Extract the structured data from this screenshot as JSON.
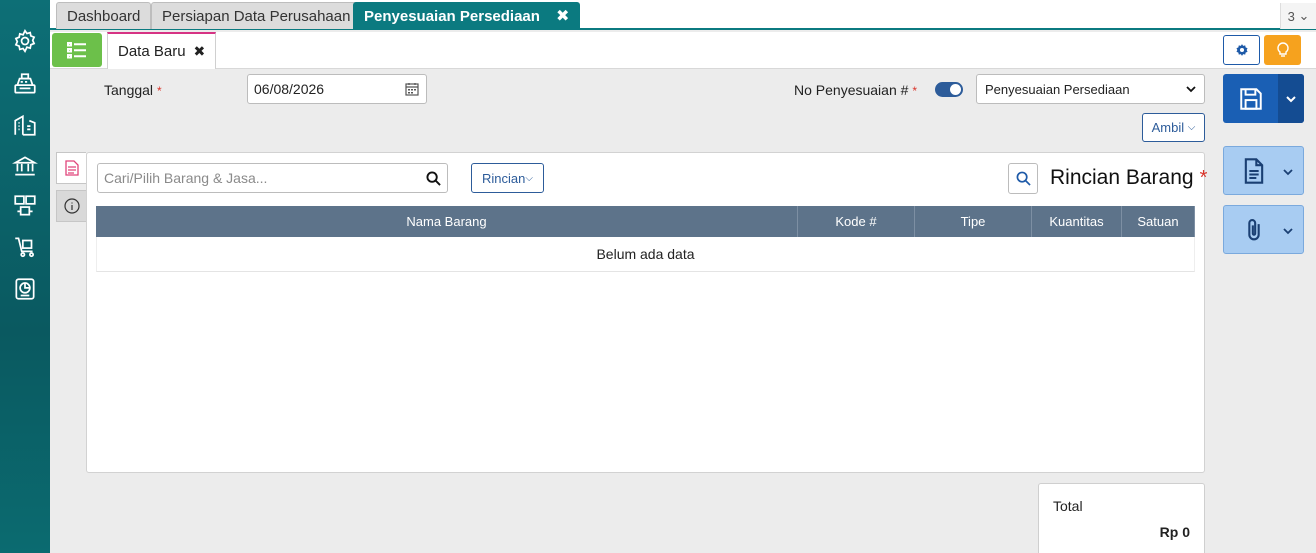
{
  "tabs": [
    {
      "label": "Dashboard",
      "active": false
    },
    {
      "label": "Persiapan Data Perusahaan",
      "active": false
    },
    {
      "label": "Penyesuaian Persediaan",
      "active": true
    }
  ],
  "tab_count": "3",
  "subtab": {
    "label": "Data Baru"
  },
  "form": {
    "tanggal_label": "Tanggal",
    "tanggal_value": "06/08/2026",
    "no_label": "No Penyesuaian #",
    "required_mark": "*",
    "select_value": "Penyesuaian Persediaan",
    "ambil_label": "Ambil"
  },
  "detail": {
    "search_placeholder": "Cari/Pilih Barang & Jasa...",
    "rincian_label": "Rincian",
    "title": "Rincian Barang",
    "columns": [
      "Nama Barang",
      "Kode #",
      "Tipe",
      "Kuantitas",
      "Satuan"
    ],
    "empty_text": "Belum ada data"
  },
  "total": {
    "label": "Total",
    "value": "Rp 0"
  },
  "colors": {
    "teal": "#0b7a80",
    "green": "#6cc04a",
    "blue": "#1a5fb4",
    "orange": "#f6a21e",
    "header": "#5d738a"
  }
}
